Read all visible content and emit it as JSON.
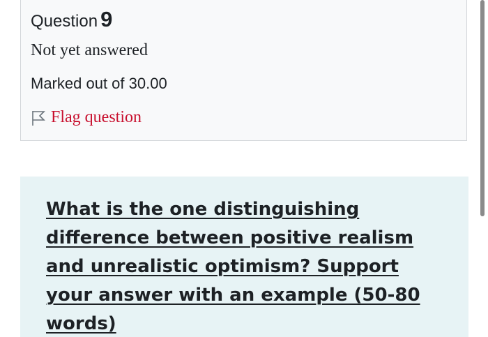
{
  "question_info": {
    "label": "Question",
    "number": "9",
    "state": "Not yet answered",
    "grade": "Marked out of 30.00",
    "flag_label": "Flag question",
    "flag_icon": "flag-outline-icon"
  },
  "question": {
    "text": "What is the one distinguishing difference between positive realism and unrealistic optimism? Support your answer with an example (50-80 words)"
  },
  "colors": {
    "info_box_bg": "#f8f9fa",
    "question_box_bg": "#e7f3f5",
    "flag_link": "#c8102e",
    "text": "#1d2125"
  }
}
